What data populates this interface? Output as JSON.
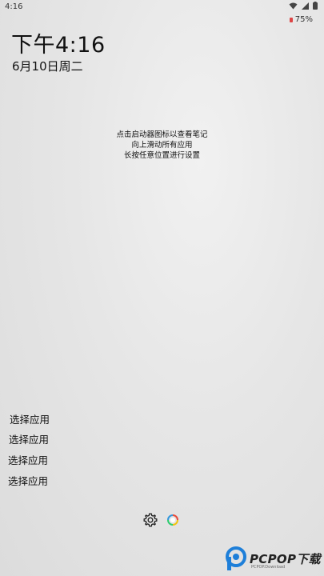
{
  "status_bar": {
    "time": "4:16",
    "battery": "75%",
    "icons": [
      "wifi-icon",
      "signal-icon",
      "battery-icon"
    ]
  },
  "clock": {
    "time": "下午4:16",
    "date": "6月10日周二"
  },
  "hints": [
    "点击启动器图标以查看笔记",
    "向上滑动所有应用",
    "长按任意位置进行设置"
  ],
  "app_slots": [
    "选择应用",
    "选择应用",
    "选择应用",
    "选择应用"
  ],
  "bottom_bar": {
    "icons": [
      "settings-icon",
      "launcher-ring-icon"
    ]
  },
  "watermark": {
    "text": "PCPOP下载",
    "subtext": "PCPOP.Download"
  },
  "colors": {
    "background": "#e6e6e6",
    "text": "#111111",
    "battery_low": "#dd4444",
    "logo_blue": "#1e7fd9"
  }
}
